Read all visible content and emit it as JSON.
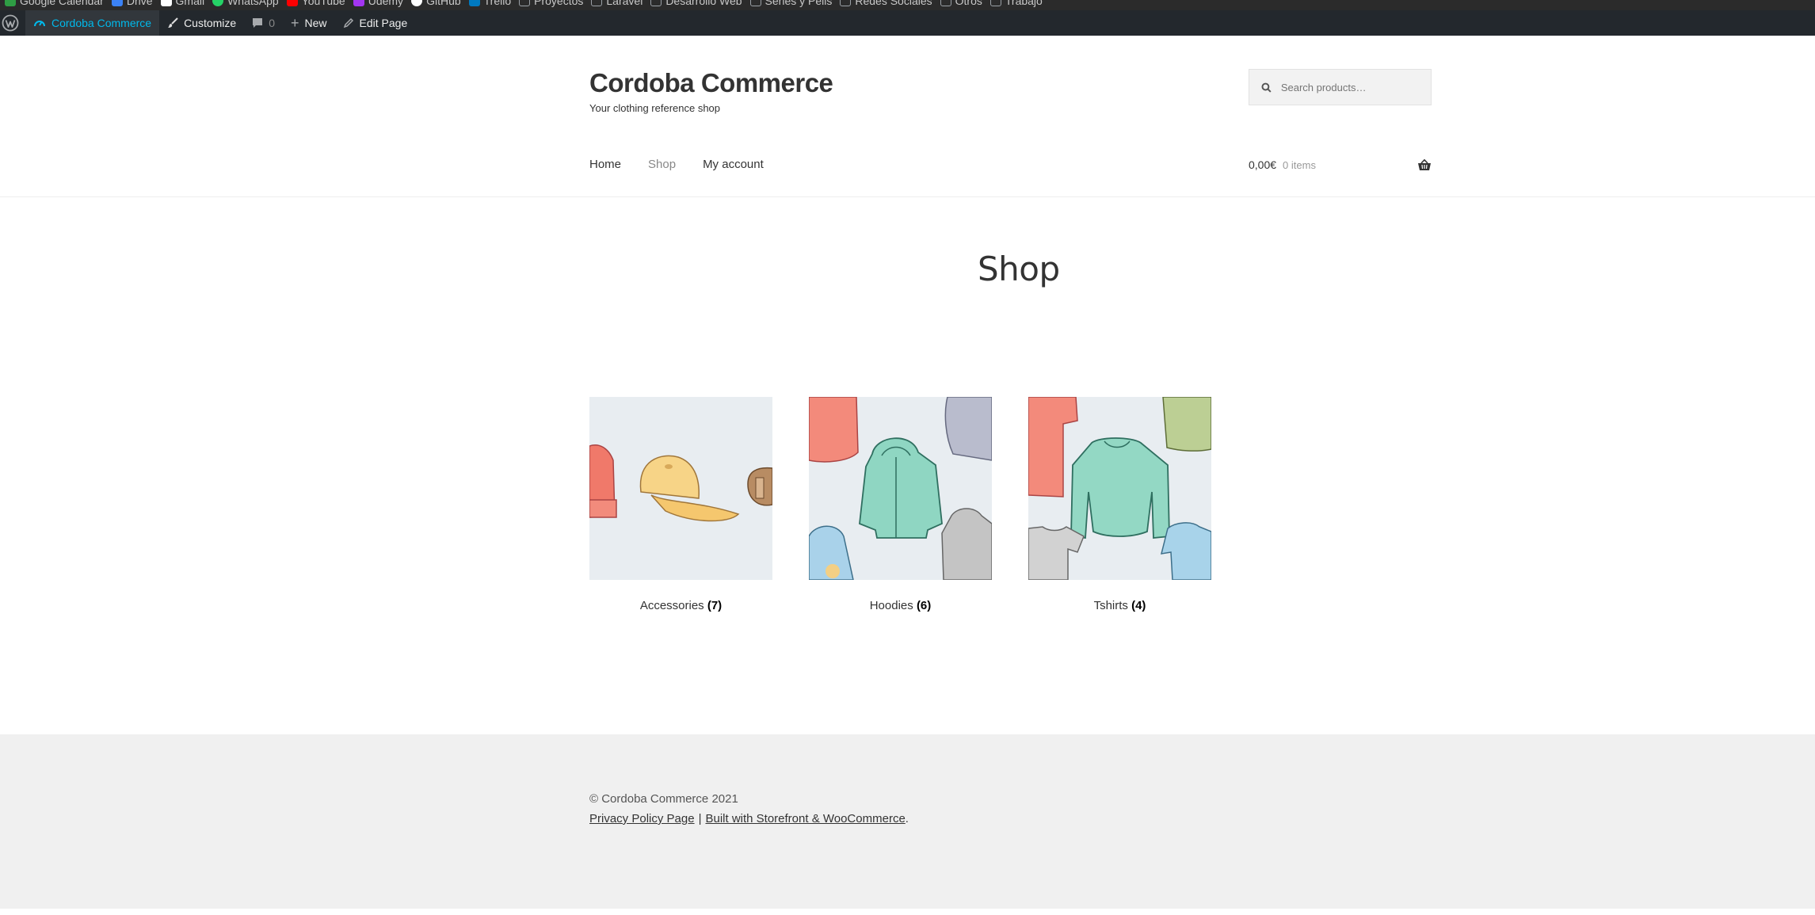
{
  "bookmarks": [
    {
      "label": "Google Calendar",
      "color": "#2f9e44"
    },
    {
      "label": "Drive",
      "color": "#3b82f6"
    },
    {
      "label": "Gmail",
      "color": "#ffffff"
    },
    {
      "label": "WhatsApp",
      "color": "#25d366"
    },
    {
      "label": "YouTube",
      "color": "#ff0000"
    },
    {
      "label": "Udemy",
      "color": "#a435f0"
    },
    {
      "label": "GitHub",
      "color": "#ffffff"
    },
    {
      "label": "Trello",
      "color": "#0079bf"
    },
    {
      "label": "Proyectos",
      "color": "#9aa0a6"
    },
    {
      "label": "Laravel",
      "color": "#9aa0a6"
    },
    {
      "label": "Desarrollo Web",
      "color": "#9aa0a6"
    },
    {
      "label": "Series y Pelis",
      "color": "#9aa0a6"
    },
    {
      "label": "Redes Sociales",
      "color": "#9aa0a6"
    },
    {
      "label": "Otros",
      "color": "#9aa0a6"
    },
    {
      "label": "Trabajo",
      "color": "#9aa0a6"
    }
  ],
  "adminbar": {
    "site_name": "Cordoba Commerce",
    "customize": "Customize",
    "comments_count": "0",
    "new": "New",
    "edit_page": "Edit Page"
  },
  "header": {
    "site_title": "Cordoba Commerce",
    "tagline": "Your clothing reference shop",
    "search_placeholder": "Search products…"
  },
  "nav": {
    "items": [
      {
        "label": "Home"
      },
      {
        "label": "Shop"
      },
      {
        "label": "My account"
      }
    ]
  },
  "cart": {
    "amount": "0,00€",
    "items": "0 items"
  },
  "page": {
    "title": "Shop"
  },
  "categories": [
    {
      "name": "Accessories",
      "count": "(7)"
    },
    {
      "name": "Hoodies",
      "count": "(6)"
    },
    {
      "name": "Tshirts",
      "count": "(4)"
    }
  ],
  "footer": {
    "copyright": "© Cordoba Commerce 2021",
    "privacy": "Privacy Policy Page",
    "separator": "|",
    "built_with": "Built with Storefront & WooCommerce",
    "period": "."
  },
  "colors": {
    "adminbar_bg": "#23282d",
    "adminbar_accent": "#00b9eb",
    "footer_bg": "#f0f0f0",
    "thumb_bg": "#e8edf1"
  }
}
